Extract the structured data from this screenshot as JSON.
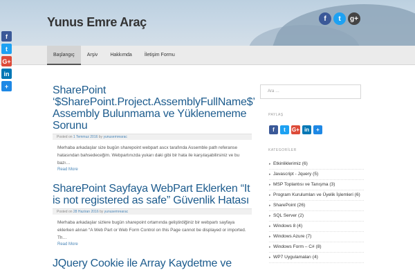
{
  "site": {
    "title": "Yunus Emre Araç"
  },
  "header_social": [
    {
      "icon": "facebook-icon",
      "glyph": "f",
      "color": "#3b5998"
    },
    {
      "icon": "twitter-icon",
      "glyph": "t",
      "color": "#1da1f2"
    },
    {
      "icon": "google-plus-icon",
      "glyph": "g+",
      "color": "#444444"
    }
  ],
  "nav": {
    "items": [
      "Başlangıç",
      "Arşiv",
      "Hakkımda",
      "İletişim Formu"
    ],
    "active": 0
  },
  "share_left": [
    {
      "icon": "facebook-icon",
      "glyph": "f",
      "color": "#3b5998"
    },
    {
      "icon": "twitter-icon",
      "glyph": "t",
      "color": "#1da1f2"
    },
    {
      "icon": "google-plus-icon",
      "glyph": "G+",
      "color": "#dd4b39"
    },
    {
      "icon": "linkedin-icon",
      "glyph": "in",
      "color": "#0077b5"
    },
    {
      "icon": "share-plus-icon",
      "glyph": "+",
      "color": "#1e88e5"
    }
  ],
  "posts": [
    {
      "title": "SharePoint ‘$SharePoint.Project.AssemblyFullName$’ Assembly Bulunmama ve Yüklenememe Sorunu",
      "meta_prefix": "Posted on",
      "date": "1 Temmuz 2016",
      "meta_by": "by",
      "author": "yunusemrearac",
      "excerpt": "Merhaba arkadaşlar size bugün sharepoint webpart ascx tarafında Assemble path referanse hatasından bahsedeceğim. Webpartınızda yukarı daki gibi bir hata ile karşılaşabilirsiniz ve bu bazı…",
      "read_more": "Read More"
    },
    {
      "title": "SharePoint Sayfaya WebPart Eklerken “It is not registered as safe” Güvenlik Hatası",
      "meta_prefix": "Posted on",
      "date": "28 Haziran 2016",
      "meta_by": "by",
      "author": "yunusemrearac",
      "excerpt": "Merhaba arkadaşlar sizlere bugün sharepoint ortamında geliştirdiğiniz bir webpartı sayfaya eklerken alınan “A Web Part or Web Form Control on this Page cannot be displayed or imported. Th…",
      "read_more": "Read More"
    },
    {
      "title": "JQuery Cookie ile Array Kaydetme ve",
      "meta_prefix": "",
      "date": "",
      "meta_by": "",
      "author": "",
      "excerpt": "",
      "read_more": ""
    }
  ],
  "sidebar": {
    "search_placeholder": "Ara …",
    "share_title": "PAYLAŞ",
    "share_buttons": [
      {
        "icon": "facebook-icon",
        "glyph": "f",
        "color": "#3b5998"
      },
      {
        "icon": "twitter-icon",
        "glyph": "t",
        "color": "#1da1f2"
      },
      {
        "icon": "google-plus-icon",
        "glyph": "G+",
        "color": "#dd4b39"
      },
      {
        "icon": "linkedin-icon",
        "glyph": "in",
        "color": "#0077b5"
      },
      {
        "icon": "share-plus-icon",
        "glyph": "+",
        "color": "#1e88e5"
      }
    ],
    "categories_title": "KATEGORİLER",
    "categories": [
      "Etkinliklerimiz (6)",
      "Javascript - Jquery (5)",
      "MSP Toplantısı ve Tanışma (3)",
      "Program Kurulumları ve Üyelik İşlemleri (6)",
      "SharePoint (26)",
      "SQL Server (2)",
      "Windows 8 (4)",
      "Windows Azure (7)",
      "Windows Form – C# (8)",
      "WP7 Uygulamaları (4)"
    ]
  }
}
